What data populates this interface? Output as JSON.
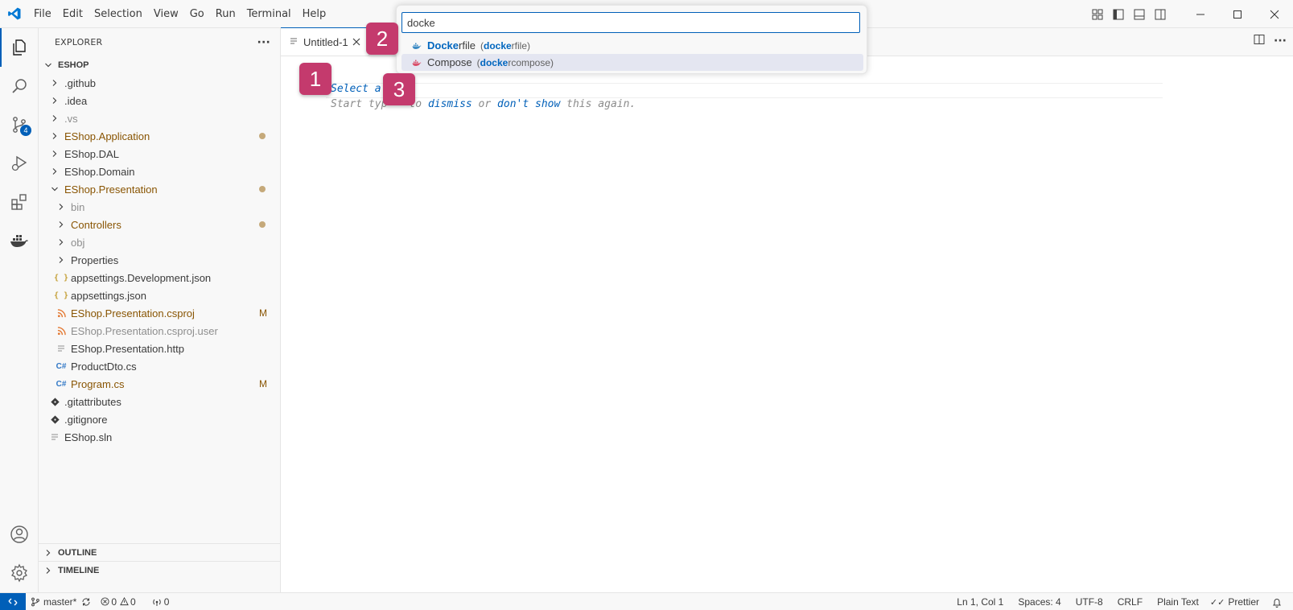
{
  "menu": [
    "File",
    "Edit",
    "Selection",
    "View",
    "Go",
    "Run",
    "Terminal",
    "Help"
  ],
  "activity": {
    "scm_badge": "4"
  },
  "sidebar": {
    "title": "EXPLORER",
    "more": "···",
    "root": "ESHOP",
    "items": [
      {
        "label": ".github",
        "color": "norm"
      },
      {
        "label": ".idea",
        "color": "norm"
      },
      {
        "label": ".vs",
        "color": "ign"
      },
      {
        "label": "EShop.Application",
        "color": "mod"
      },
      {
        "label": "EShop.DAL",
        "color": "norm"
      },
      {
        "label": "EShop.Domain",
        "color": "norm"
      },
      {
        "label": "EShop.Presentation",
        "color": "mod"
      },
      {
        "label": "bin",
        "color": "ign"
      },
      {
        "label": "Controllers",
        "color": "mod"
      },
      {
        "label": "obj",
        "color": "ign"
      },
      {
        "label": "Properties",
        "color": "norm"
      },
      {
        "label": "appsettings.Development.json",
        "color": "norm"
      },
      {
        "label": "appsettings.json",
        "color": "norm"
      },
      {
        "label": "EShop.Presentation.csproj",
        "color": "mod",
        "decoration": "M"
      },
      {
        "label": "EShop.Presentation.csproj.user",
        "color": "ign"
      },
      {
        "label": "EShop.Presentation.http",
        "color": "norm"
      },
      {
        "label": "ProductDto.cs",
        "color": "norm"
      },
      {
        "label": "Program.cs",
        "color": "mod",
        "decoration": "M"
      },
      {
        "label": ".gitattributes",
        "color": "norm"
      },
      {
        "label": ".gitignore",
        "color": "norm"
      },
      {
        "label": "EShop.sln",
        "color": "norm"
      }
    ],
    "outline": "OUTLINE",
    "timeline": "TIMELINE"
  },
  "editor": {
    "tab": "Untitled-1",
    "line_number": "1",
    "hint_line1": "Select a la",
    "hint_line2_a": "Start typ",
    "hint_line2_b": "to ",
    "hint_line2_c": "dismiss",
    "hint_line2_d": " or ",
    "hint_line2_e": "don't show",
    "hint_line2_f": " this again."
  },
  "quickpick": {
    "value": "docke",
    "items": [
      {
        "hl": "Docke",
        "rest": "rfile",
        "desc_hl": "docke",
        "desc_rest": "rfile"
      },
      {
        "hl": "",
        "rest": "Compose",
        "desc_hl": "docke",
        "desc_rest": "rcompose"
      }
    ]
  },
  "markers": [
    "1",
    "2",
    "3"
  ],
  "status": {
    "branch": "master*",
    "errors": "0",
    "warnings": "0",
    "ports": "0",
    "position": "Ln 1, Col 1",
    "spaces": "Spaces: 4",
    "encoding": "UTF-8",
    "eol": "CRLF",
    "language": "Plain Text",
    "prettier": "Prettier"
  }
}
